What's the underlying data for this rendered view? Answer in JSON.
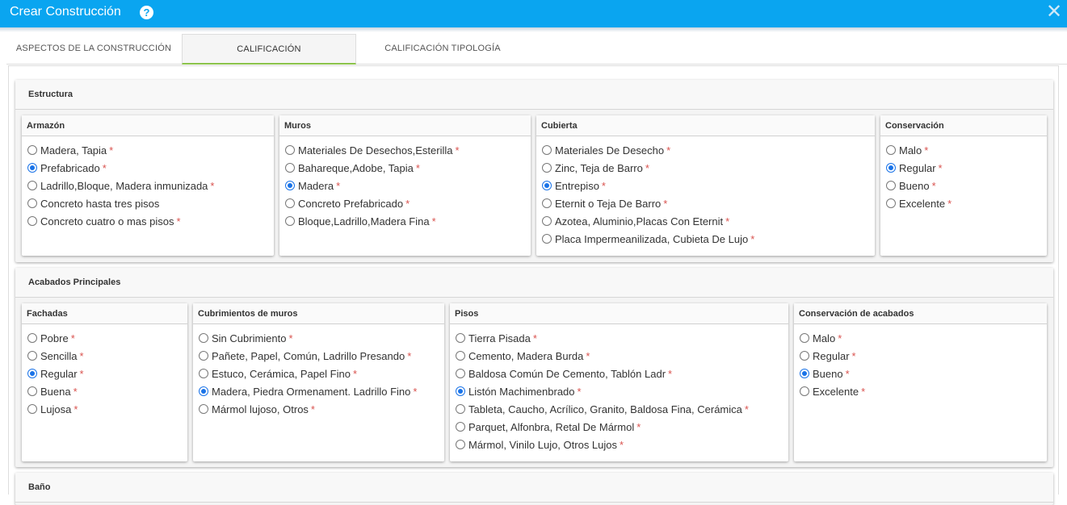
{
  "window": {
    "title": "Crear Construcción",
    "help": "?",
    "close": "✕"
  },
  "tabs": [
    {
      "label": "ASPECTOS DE LA CONSTRUCCIÓN"
    },
    {
      "label": "CALIFICACIÓN"
    },
    {
      "label": "CALIFICACIÓN TIPOLOGÍA"
    }
  ],
  "active_tab": "CALIFICACIÓN",
  "required_mark": "*",
  "sections": {
    "estructura": {
      "title": "Estructura",
      "groups": {
        "armazon": {
          "title": "Armazón",
          "selected": "Prefabricado",
          "options": [
            {
              "label": "Madera, Tapia",
              "required": true
            },
            {
              "label": "Prefabricado",
              "required": true
            },
            {
              "label": "Ladrillo,Bloque, Madera inmunizada",
              "required": true
            },
            {
              "label": "Concreto hasta tres pisos",
              "required": false
            },
            {
              "label": "Concreto cuatro o mas pisos",
              "required": true
            }
          ]
        },
        "muros": {
          "title": "Muros",
          "selected": "Madera",
          "options": [
            {
              "label": "Materiales De Desechos,Esterilla",
              "required": true
            },
            {
              "label": "Bahareque,Adobe, Tapia",
              "required": true
            },
            {
              "label": "Madera",
              "required": true
            },
            {
              "label": "Concreto Prefabricado",
              "required": true
            },
            {
              "label": "Bloque,Ladrillo,Madera Fina",
              "required": true
            }
          ]
        },
        "cubierta": {
          "title": "Cubierta",
          "selected": "Entrepiso",
          "options": [
            {
              "label": "Materiales De Desecho",
              "required": true
            },
            {
              "label": "Zinc, Teja de Barro",
              "required": true
            },
            {
              "label": "Entrepiso",
              "required": true
            },
            {
              "label": "Eternit o Teja De Barro",
              "required": true
            },
            {
              "label": "Azotea, Aluminio,Placas Con Eternit",
              "required": true
            },
            {
              "label": "Placa Impermeanilizada, Cubieta De Lujo",
              "required": true
            }
          ]
        },
        "conservacion": {
          "title": "Conservación",
          "selected": "Regular",
          "options": [
            {
              "label": "Malo",
              "required": true
            },
            {
              "label": "Regular",
              "required": true
            },
            {
              "label": "Bueno",
              "required": true
            },
            {
              "label": "Excelente",
              "required": true
            }
          ]
        }
      }
    },
    "acabados": {
      "title": "Acabados Principales",
      "groups": {
        "fachadas": {
          "title": "Fachadas",
          "selected": "Regular",
          "options": [
            {
              "label": "Pobre",
              "required": true
            },
            {
              "label": "Sencilla",
              "required": true
            },
            {
              "label": "Regular",
              "required": true
            },
            {
              "label": "Buena",
              "required": true
            },
            {
              "label": "Lujosa",
              "required": true
            }
          ]
        },
        "cubrimientos": {
          "title": "Cubrimientos de muros",
          "selected": "Madera, Piedra Ormenament. Ladrillo Fino",
          "options": [
            {
              "label": "Sin Cubrimiento",
              "required": true
            },
            {
              "label": "Pañete, Papel, Común, Ladrillo Presando",
              "required": true
            },
            {
              "label": "Estuco, Cerámica, Papel Fino",
              "required": true
            },
            {
              "label": "Madera, Piedra Ormenament. Ladrillo Fino",
              "required": true
            },
            {
              "label": "Mármol lujoso, Otros",
              "required": true
            }
          ]
        },
        "pisos": {
          "title": "Pisos",
          "selected": "Listón Machimenbrado",
          "options": [
            {
              "label": "Tierra Pisada",
              "required": true
            },
            {
              "label": "Cemento, Madera Burda",
              "required": true
            },
            {
              "label": "Baldosa Común De Cemento, Tablón Ladr",
              "required": true
            },
            {
              "label": "Listón Machimenbrado",
              "required": true
            },
            {
              "label": "Tableta, Caucho, Acrílico, Granito, Baldosa Fina, Cerámica",
              "required": true
            },
            {
              "label": "Parquet, Alfonbra, Retal De Mármol",
              "required": true
            },
            {
              "label": "Mármol, Vinilo Lujo, Otros Lujos",
              "required": true
            }
          ]
        },
        "conservacion_acabados": {
          "title": "Conservación de acabados",
          "selected": "Bueno",
          "options": [
            {
              "label": "Malo",
              "required": true
            },
            {
              "label": "Regular",
              "required": true
            },
            {
              "label": "Bueno",
              "required": true
            },
            {
              "label": "Excelente",
              "required": true
            }
          ]
        }
      }
    },
    "bano": {
      "title": "Baño"
    }
  }
}
